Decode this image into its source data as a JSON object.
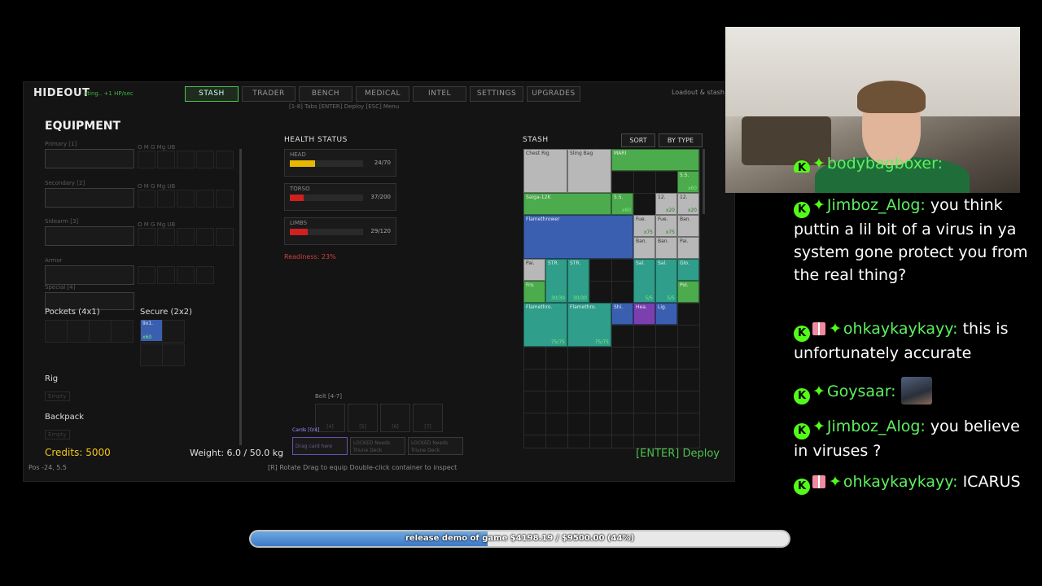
{
  "game": {
    "title": "HIDEOUT",
    "subtitle": "ating.. +1 HP/sec",
    "tabs": [
      "STASH",
      "TRADER",
      "BENCH",
      "MEDICAL",
      "INTEL",
      "SETTINGS",
      "UPGRADES"
    ],
    "active_tab": "STASH",
    "hints": "[1-8] Tabs  [ENTER] Deploy  [ESC] Menu",
    "top_right": "Loadout & stash",
    "equipment": {
      "title": "EQUIPMENT",
      "slots": [
        {
          "label": "Primary [1]"
        },
        {
          "label": "Secondary [2]"
        },
        {
          "label": "Sidearm [3]"
        },
        {
          "label": "Armor"
        },
        {
          "label": "Special [4]"
        }
      ],
      "mod_labels": "O  M  G  Mg  UB",
      "pockets": "Pockets (4x1)",
      "secure": "Secure (2x2)",
      "secure_item": {
        "name": "9x1.",
        "qty": "x60"
      },
      "rig": "Rig",
      "backpack": "Backpack",
      "empty": "Empty"
    },
    "health": {
      "title": "HEALTH STATUS",
      "parts": [
        {
          "name": "HEAD",
          "value": "24/70",
          "level": 0.34,
          "color": "#e6b800"
        },
        {
          "name": "TORSO",
          "value": "37/200",
          "level": 0.185,
          "color": "#d02020"
        },
        {
          "name": "LIMBS",
          "value": "29/120",
          "level": 0.24,
          "color": "#d02020"
        }
      ],
      "readiness": "Readiness: 23%"
    },
    "belt": {
      "label": "Belt [4-7]",
      "slots": [
        "[4]",
        "[5]",
        "[6]",
        "[7]"
      ]
    },
    "cards": {
      "label": "Cards [0/4]",
      "drop": "Drag card here",
      "locked1": "LOCKED Needs Triune Deck",
      "locked2": "LOCKED Needs Triune Deck"
    },
    "stash": {
      "title": "STASH",
      "sort": "SORT",
      "by_type": "BY TYPE",
      "items": [
        {
          "name": "Chest Rig",
          "qty": "",
          "cls": "grey"
        },
        {
          "name": "Sling Bag",
          "qty": "",
          "cls": "grey"
        },
        {
          "name": "MARI",
          "qty": "",
          "cls": "green"
        },
        {
          "name": "5.5.",
          "qty": "x60",
          "cls": "green"
        },
        {
          "name": "Saiga-12K",
          "qty": "",
          "cls": "green"
        },
        {
          "name": "5.5.",
          "qty": "x60",
          "cls": "green"
        },
        {
          "name": "12.",
          "qty": "x20",
          "cls": "grey"
        },
        {
          "name": "12.",
          "qty": "x20",
          "cls": "grey"
        },
        {
          "name": "Flamethrower",
          "qty": "",
          "cls": "blue"
        },
        {
          "name": "Fue.",
          "qty": "x75",
          "cls": "grey"
        },
        {
          "name": "Fue.",
          "qty": "x75",
          "cls": "grey"
        },
        {
          "name": "Ban.",
          "qty": "",
          "cls": "grey"
        },
        {
          "name": "Ban.",
          "qty": "",
          "cls": "grey"
        },
        {
          "name": "Ban.",
          "qty": "",
          "cls": "grey"
        },
        {
          "name": "Pai.",
          "qty": "",
          "cls": "grey"
        },
        {
          "name": "Pai.",
          "qty": "",
          "cls": "grey"
        },
        {
          "name": "STR.",
          "qty": "30/30",
          "cls": "teal"
        },
        {
          "name": "STR.",
          "qty": "30/30",
          "cls": "teal"
        },
        {
          "name": "Sal.",
          "qty": "5/5",
          "cls": "teal"
        },
        {
          "name": "Sal.",
          "qty": "5/5",
          "cls": "teal"
        },
        {
          "name": "Glo.",
          "qty": "",
          "cls": "teal"
        },
        {
          "name": "Fro.",
          "qty": "",
          "cls": "green"
        },
        {
          "name": "Pol.",
          "qty": "",
          "cls": "green"
        },
        {
          "name": "Flamethro.",
          "qty": "75/75",
          "cls": "teal"
        },
        {
          "name": "Flamethro.",
          "qty": "75/75",
          "cls": "teal"
        },
        {
          "name": "Shi.",
          "qty": "",
          "cls": "blue"
        },
        {
          "name": "Hea.",
          "qty": "",
          "cls": "purple"
        },
        {
          "name": "Lig.",
          "qty": "",
          "cls": "blue"
        }
      ]
    },
    "credits": "Credits: 5000",
    "weight": "Weight: 6.0 / 50.0 kg",
    "pos": "Pos -24, 5.5",
    "bottom_hints": "[R] Rotate    Drag to equip    Double-click container to inspect",
    "deploy": "[ENTER] Deploy"
  },
  "chat": {
    "cutoff_user": "bodybagboxer:",
    "messages": [
      {
        "user": "Jimboz_Alog:",
        "gift": false,
        "text": "you think puttin a lil bit of a virus in ya system gone protect you from the real thing?"
      },
      {
        "user": "ohkaykaykayy:",
        "gift": true,
        "text": "this is unfortunately accurate"
      },
      {
        "user": "Goysaar:",
        "gift": false,
        "text": ""
      },
      {
        "user": "Jimboz_Alog:",
        "gift": false,
        "text": "you believe in viruses ?"
      },
      {
        "user": "ohkaykaykayy:",
        "gift": true,
        "text": "ICARUS"
      }
    ],
    "badge_letter": "K",
    "diamond": "✦"
  },
  "goal": {
    "text": "release demo of game $4198.19 / $9500.00 (44%)",
    "progress": 0.44
  }
}
